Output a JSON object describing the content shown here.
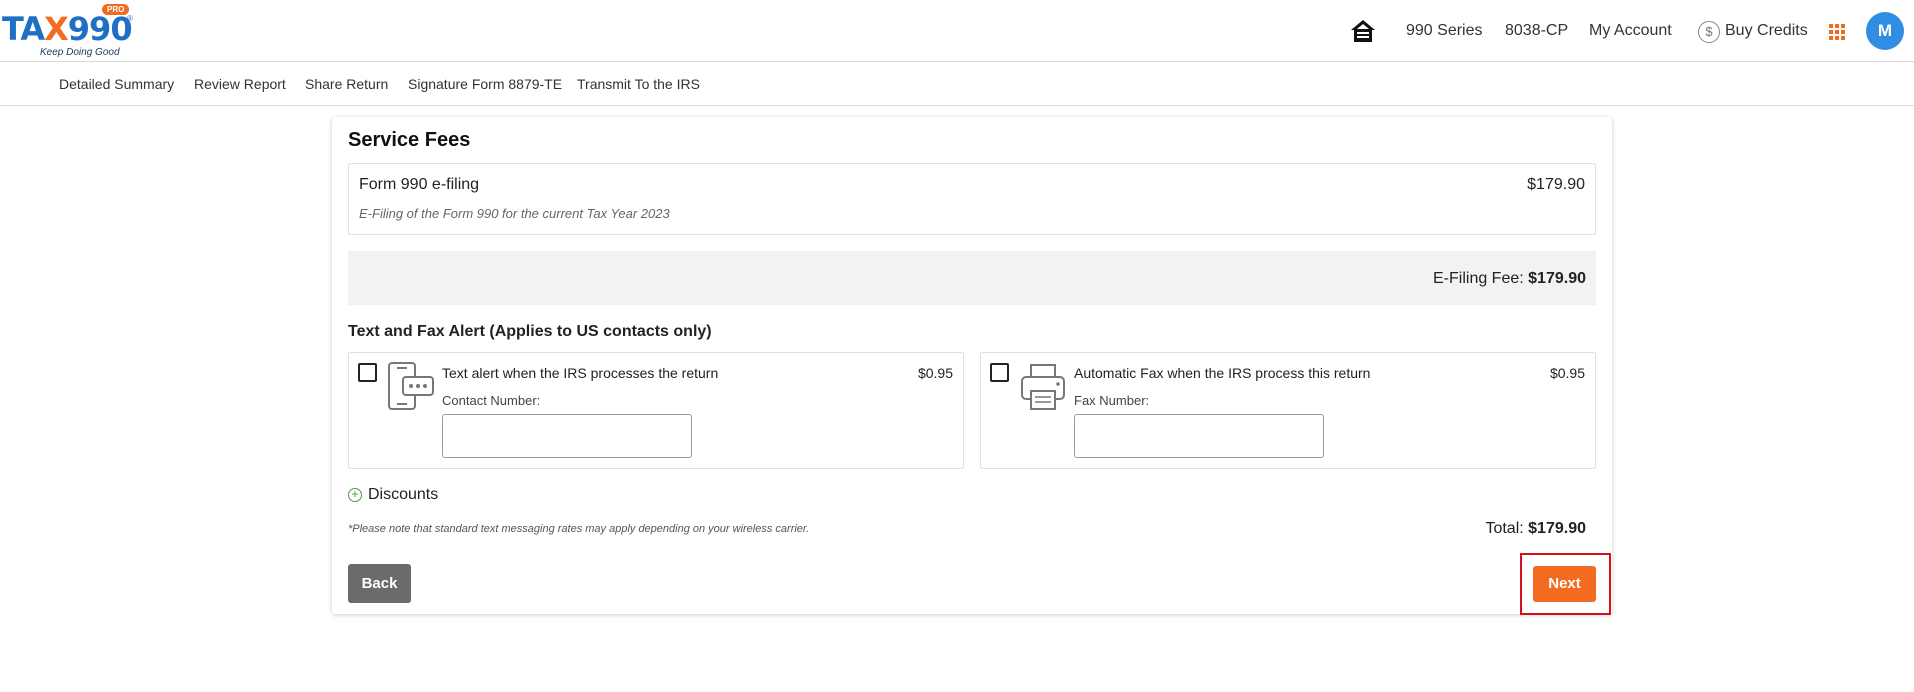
{
  "header": {
    "logo": {
      "brand_prefix": "TA",
      "brand_x": "X",
      "brand_suffix": "990",
      "badge": "PRO",
      "registered": "®",
      "tagline": "Keep Doing Good"
    },
    "nav": [
      "990 Series",
      "8038-CP",
      "My Account"
    ],
    "buy_credits": "Buy Credits",
    "avatar_initial": "M",
    "icons": {
      "home": "home-icon",
      "credits": "dollar-coin-icon",
      "apps": "apps-grid-icon"
    },
    "accent_color": "#f26b21",
    "brand_color": "#1f6fc5"
  },
  "subnav": [
    "Detailed Summary",
    "Review Report",
    "Share Return",
    "Signature Form 8879-TE",
    "Transmit To the IRS"
  ],
  "service_fees": {
    "title": "Service Fees",
    "fee_item": {
      "name": "Form 990 e-filing",
      "price": "$179.90",
      "description": "E-Filing of the Form 990 for the current Tax Year 2023"
    },
    "efiling_fee_label": "E-Filing Fee:",
    "efiling_fee_value": "$179.90",
    "alerts_heading": "Text and Fax Alert (Applies to US contacts only)",
    "text_alert": {
      "title": "Text alert when the IRS processes the return",
      "price": "$0.95",
      "field_label": "Contact Number:",
      "value": "",
      "checked": false,
      "icon": "phone-message-icon"
    },
    "fax_alert": {
      "title": "Automatic Fax when the IRS process this return",
      "price": "$0.95",
      "field_label": "Fax Number:",
      "value": "",
      "checked": false,
      "icon": "printer-icon"
    },
    "discounts_label": "Discounts",
    "note": "*Please note that standard text messaging rates may apply depending on your wireless carrier.",
    "total_label": "Total:",
    "total_value": "$179.90",
    "back_label": "Back",
    "next_label": "Next"
  }
}
